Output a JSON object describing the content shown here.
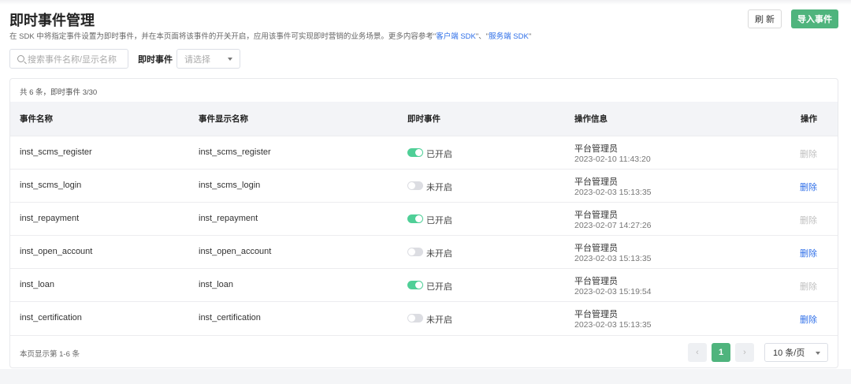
{
  "header": {
    "title": "即时事件管理",
    "description": "在 SDK 中将指定事件设置为即时事件，并在本页面将该事件的开关开启，应用该事件可实现即时营销的业务场景。更多内容参考",
    "link1": "客户端 SDK",
    "sep": "、",
    "link2": "服务端 SDK",
    "refresh_label": "刷 新",
    "import_label": "导入事件"
  },
  "filters": {
    "search_placeholder": "搜索事件名称/显示名称",
    "instant_label": "即时事件",
    "select_placeholder": "请选择"
  },
  "table": {
    "summary": "共 6 条，即时事件 3/30",
    "columns": [
      "事件名称",
      "事件显示名称",
      "即时事件",
      "操作信息",
      "操作"
    ],
    "rows": [
      {
        "name": "inst_scms_register",
        "display": "inst_scms_register",
        "on": true,
        "status": "已开启",
        "operator": "平台管理员",
        "time": "2023-02-10 11:43:20",
        "action": "删除",
        "action_enabled": false
      },
      {
        "name": "inst_scms_login",
        "display": "inst_scms_login",
        "on": false,
        "status": "未开启",
        "operator": "平台管理员",
        "time": "2023-02-03 15:13:35",
        "action": "删除",
        "action_enabled": true
      },
      {
        "name": "inst_repayment",
        "display": "inst_repayment",
        "on": true,
        "status": "已开启",
        "operator": "平台管理员",
        "time": "2023-02-07 14:27:26",
        "action": "删除",
        "action_enabled": false
      },
      {
        "name": "inst_open_account",
        "display": "inst_open_account",
        "on": false,
        "status": "未开启",
        "operator": "平台管理员",
        "time": "2023-02-03 15:13:35",
        "action": "删除",
        "action_enabled": true
      },
      {
        "name": "inst_loan",
        "display": "inst_loan",
        "on": true,
        "status": "已开启",
        "operator": "平台管理员",
        "time": "2023-02-03 15:19:54",
        "action": "删除",
        "action_enabled": false
      },
      {
        "name": "inst_certification",
        "display": "inst_certification",
        "on": false,
        "status": "未开启",
        "operator": "平台管理员",
        "time": "2023-02-03 15:13:35",
        "action": "删除",
        "action_enabled": true
      }
    ]
  },
  "pagination": {
    "info": "本页显示第 1-6 条",
    "prev": "‹",
    "current": "1",
    "next": "›",
    "page_size": "10 条/页"
  },
  "colors": {
    "accent": "#4fb47d",
    "link": "#2f6fe8",
    "toggle_on": "#4fcf97"
  }
}
